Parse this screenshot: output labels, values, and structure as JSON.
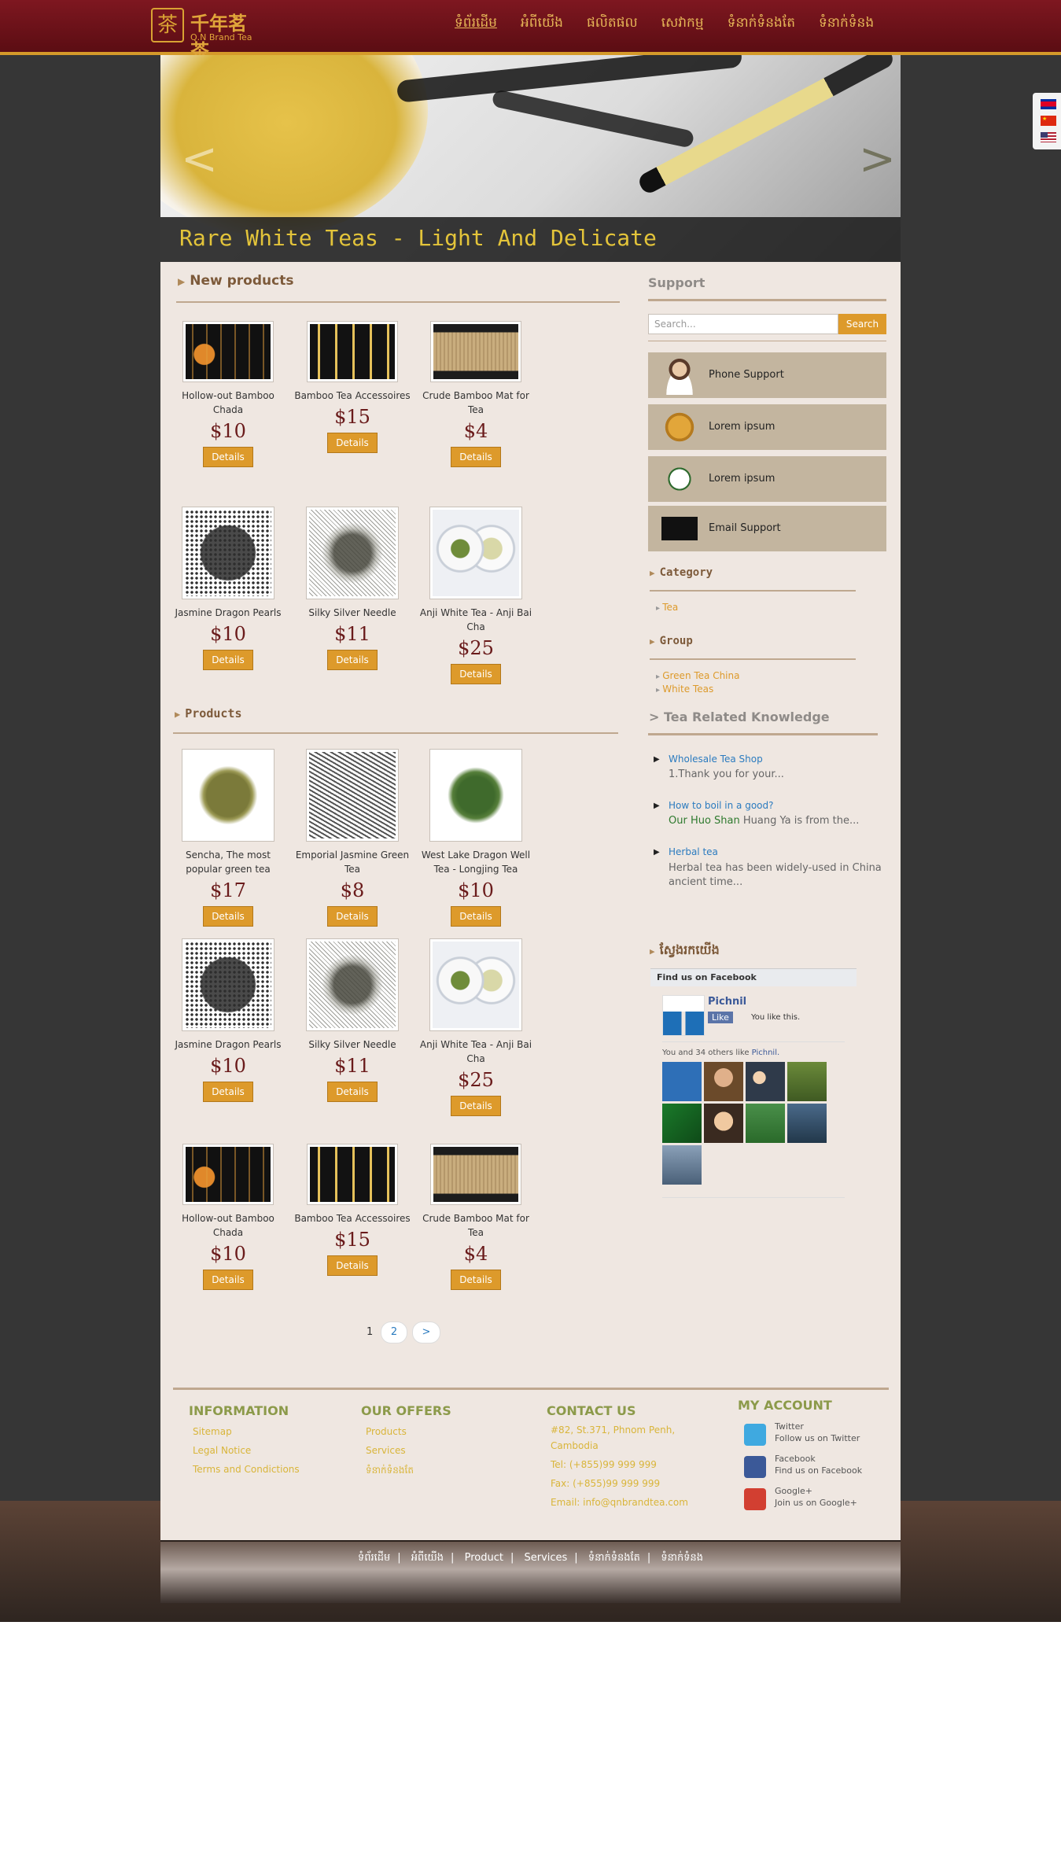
{
  "header": {
    "logo_cn": "千年茗茶",
    "logo_en": "Q.N Brand Tea",
    "nav": [
      "ទំព័រដើម",
      "អំពីយើង",
      "ផលិតផល",
      "សេវាកម្ម",
      "ទំនាក់ទំនងតែ",
      "ទំនាក់ទំនង"
    ]
  },
  "slider": {
    "caption": "Rare White Teas - Light And Delicate",
    "prev": "<",
    "next": ">"
  },
  "sections": {
    "new_products": "New products",
    "products": "Products"
  },
  "new_products": [
    {
      "name": "Hollow-out Bamboo Chada",
      "price": "$10",
      "button": "Details",
      "image": "bamboo-tools"
    },
    {
      "name": "Bamboo Tea Accessoires",
      "price": "$15",
      "button": "Details",
      "image": "bamboo-acc"
    },
    {
      "name": "Crude Bamboo Mat for Tea",
      "price": "$4",
      "button": "Details",
      "image": "bamboo-mat"
    },
    {
      "name": "Jasmine Dragon Pearls",
      "price": "$10",
      "button": "Details",
      "image": "pearls"
    },
    {
      "name": "Silky Silver Needle",
      "price": "$11",
      "button": "Details",
      "image": "needle"
    },
    {
      "name": "Anji White Tea - Anji Bai Cha",
      "price": "$25",
      "button": "Details",
      "image": "anji"
    }
  ],
  "products": [
    {
      "name": "Sencha, The most popular green tea",
      "price": "$17",
      "button": "Details",
      "image": "sencha"
    },
    {
      "name": "Emporial Jasmine Green Tea",
      "price": "$8",
      "button": "Details",
      "image": "jasmine"
    },
    {
      "name": "West Lake Dragon Well Tea - Longjing Tea",
      "price": "$10",
      "button": "Details",
      "image": "dragonwell"
    },
    {
      "name": "Jasmine Dragon Pearls",
      "price": "$10",
      "button": "Details",
      "image": "pearls"
    },
    {
      "name": "Silky Silver Needle",
      "price": "$11",
      "button": "Details",
      "image": "needle"
    },
    {
      "name": "Anji White Tea - Anji Bai Cha",
      "price": "$25",
      "button": "Details",
      "image": "anji"
    },
    {
      "name": "Hollow-out Bamboo Chada",
      "price": "$10",
      "button": "Details",
      "image": "bamboo-tools"
    },
    {
      "name": "Bamboo Tea Accessoires",
      "price": "$15",
      "button": "Details",
      "image": "bamboo-acc"
    },
    {
      "name": "Crude Bamboo Mat for Tea",
      "price": "$4",
      "button": "Details",
      "image": "bamboo-mat"
    }
  ],
  "pagination": {
    "current": "1",
    "page2": "2",
    "next": ">"
  },
  "sidebar": {
    "support_title": "Support",
    "search_placeholder": "Search...",
    "search_button": "Search",
    "support_items": [
      "Phone Support",
      "Lorem ipsum",
      "Lorem ipsum",
      "Email Support"
    ],
    "category_title": "Category",
    "categories": [
      "Tea"
    ],
    "group_title": "Group",
    "groups": [
      "Green Tea China",
      "White Teas"
    ],
    "knowledge_title": "> Tea Related Knowledge",
    "knowledge": [
      {
        "title": "Wholesale Tea Shop",
        "text": "1.Thank you for your..."
      },
      {
        "title": "How to boil in a good?",
        "text_highlight": "Our Huo Shan",
        "text": " Huang Ya is from the..."
      },
      {
        "title": "Herbal tea",
        "text": "Herbal tea has been widely-used in China ancient time..."
      }
    ],
    "find_us_title": "ស្វែងរកយើង"
  },
  "facebook": {
    "header": "Find us on Facebook",
    "page_name": "Pichnil",
    "like_button": "Like",
    "liked_text": "You like this.",
    "count_prefix": "You and 34 others like ",
    "count_page": "Pichnil."
  },
  "footer": {
    "info_title": "INFORMATION",
    "info_links": [
      "Sitemap",
      "Legal Notice",
      "Terms and Condictions"
    ],
    "offers_title": "OUR OFFERS",
    "offers_links": [
      "Products",
      "Services",
      "ទំនាក់ទំនងតែ"
    ],
    "contact_title": "CONTACT US",
    "contact_lines": [
      "#82, St.371, Phnom Penh, Cambodia",
      "Tel: (+855)99 999 999",
      "Fax: (+855)99 999 999",
      "Email: info@qnbrandtea.com"
    ],
    "account_title": "MY ACCOUNT",
    "social": [
      {
        "name": "Twitter",
        "desc": "Follow us on Twitter",
        "color": "#3fa9e0"
      },
      {
        "name": "Facebook",
        "desc": "Find us on Facebook",
        "color": "#3b5998"
      },
      {
        "name": "Google+",
        "desc": "Join us on Google+",
        "color": "#d23f31"
      }
    ]
  },
  "bottom_nav": [
    "ទំព័រដើម",
    "អំពីយើង",
    "Product",
    "Services",
    "ទំនាក់ទំនងតែ",
    "ទំនាក់ទំនង"
  ],
  "colors": {
    "accent": "#dd9a2b",
    "header_red": "#6e131a",
    "price": "#6a1b1b"
  }
}
